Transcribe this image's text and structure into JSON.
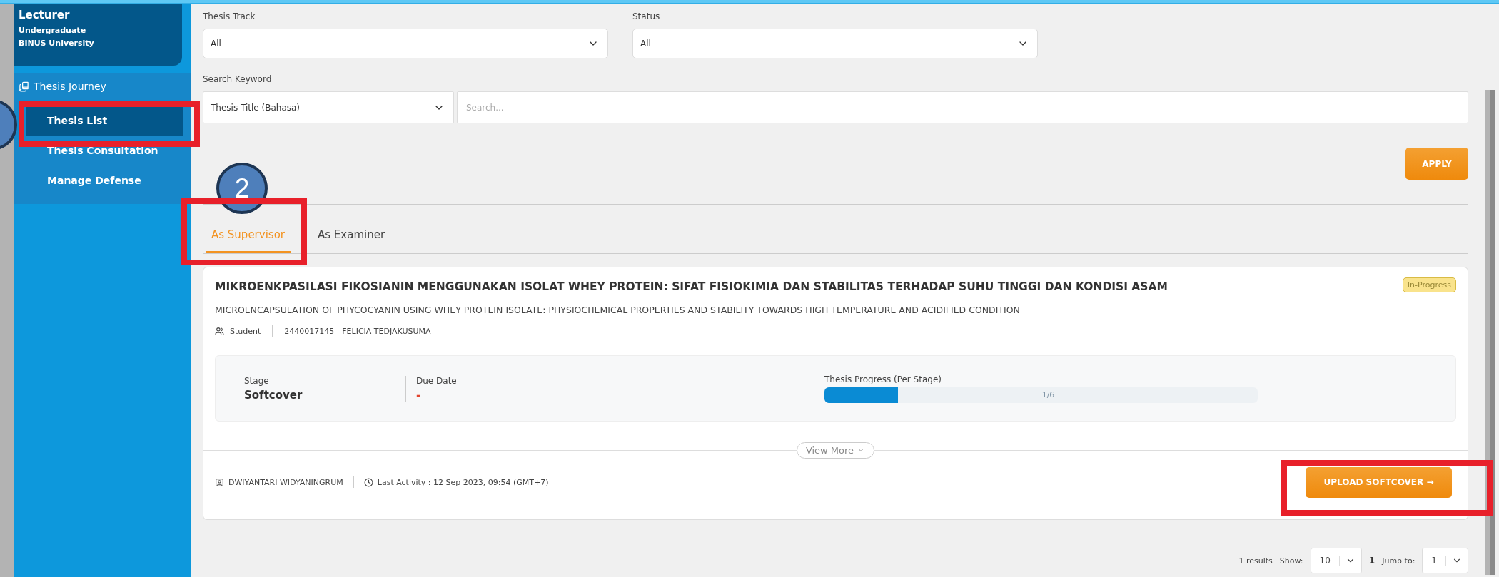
{
  "sidebar": {
    "profile": {
      "role": "Lecturer",
      "program": "Undergraduate",
      "institution": "BINUS University"
    },
    "section": {
      "label": "Thesis Journey"
    },
    "items": [
      {
        "label": "Thesis List",
        "selected": true
      },
      {
        "label": "Thesis Consultation",
        "selected": false
      },
      {
        "label": "Manage Defense",
        "selected": false
      }
    ]
  },
  "filters": {
    "thesis_track": {
      "label": "Thesis Track",
      "value": "All"
    },
    "status": {
      "label": "Status",
      "value": "All"
    },
    "search_keyword": {
      "label": "Search Keyword",
      "field": "Thesis Title (Bahasa)",
      "placeholder": "Search..."
    },
    "apply_button": "APPLY"
  },
  "tabs": [
    {
      "label": "As Supervisor",
      "selected": true
    },
    {
      "label": "As Examiner",
      "selected": false
    }
  ],
  "thesis_cards": [
    {
      "title_id": "MIKROENKPASILASI FIKOSIANIN MENGGUNAKAN ISOLAT WHEY PROTEIN: SIFAT FISIOKIMIA DAN STABILITAS TERHADAP SUHU TINGGI DAN KONDISI ASAM",
      "title_en": "MICROENCAPSULATION OF PHYCOCYANIN USING WHEY PROTEIN ISOLATE: PHYSIOCHEMICAL PROPERTIES AND STABILITY TOWARDS HIGH TEMPERATURE AND ACIDIFIED CONDITION",
      "student_label": "Student",
      "student": "2440017145 - FELICIA TEDJAKUSUMA",
      "status": "In-Progress",
      "stage_label": "Stage",
      "stage": "Softcover",
      "due_label": "Due Date",
      "due": "-",
      "progress_label": "Thesis Progress (Per Stage)",
      "progress": {
        "level": 0.17,
        "reading": "1/6"
      },
      "view_more": "View More",
      "supervisor": "DWIYANTARI WIDYANINGRUM",
      "last_activity": "Last Activity : 12 Sep 2023, 09:54 (GMT+7)",
      "action_button": "UPLOAD SOFTCOVER →"
    }
  ],
  "pagination": {
    "results": "1 results",
    "show_label": "Show:",
    "page_size": "10",
    "page": "1",
    "jump_label": "Jump to:",
    "jump_value": "1"
  },
  "annotations": [
    {
      "kind": "circle"
    },
    {
      "kind": "box"
    },
    {
      "kind": "circle",
      "label": "2"
    },
    {
      "kind": "box"
    },
    {
      "kind": "box"
    }
  ]
}
